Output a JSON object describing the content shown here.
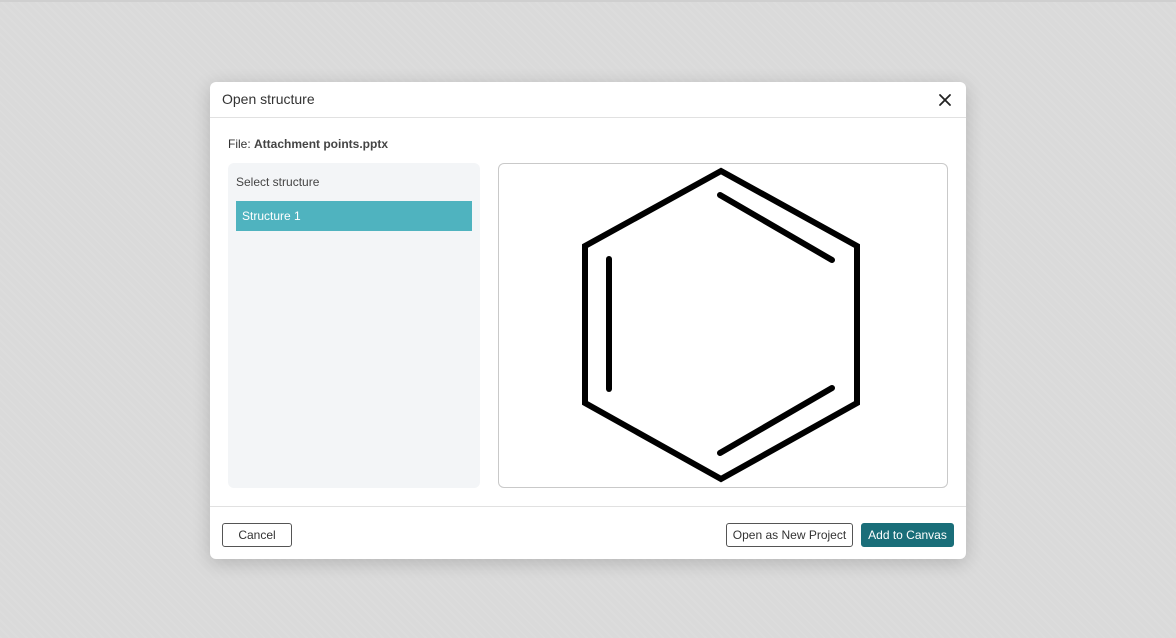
{
  "dialog": {
    "title": "Open structure",
    "file_label": "File:",
    "file_name": "Attachment points.pptx"
  },
  "structure_list": {
    "label": "Select structure",
    "items": [
      {
        "label": "Structure 1",
        "selected": true
      }
    ]
  },
  "preview": {
    "molecule": "benzene"
  },
  "footer": {
    "cancel_label": "Cancel",
    "open_new_label": "Open as New Project",
    "add_label": "Add to Canvas"
  },
  "colors": {
    "selected_item": "#4fb3bf",
    "primary_button": "#1a6e79",
    "panel_bg": "#f3f5f7"
  },
  "icons": {
    "close": "close-icon"
  }
}
